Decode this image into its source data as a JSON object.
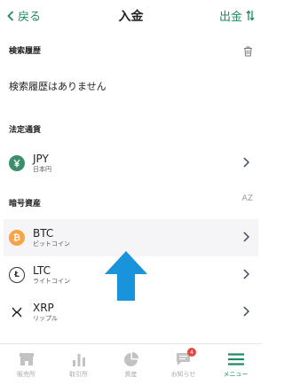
{
  "header": {
    "back_label": "戻る",
    "title": "入金",
    "withdraw_label": "出金"
  },
  "search_history": {
    "heading": "検索履歴",
    "empty_text": "検索履歴はありません"
  },
  "fiat": {
    "heading": "法定通貨",
    "items": [
      {
        "symbol": "JPY",
        "name": "日本円",
        "icon": "yen-icon",
        "color": "#3d8f6c"
      }
    ]
  },
  "crypto": {
    "heading": "暗号資産",
    "sort_label": "AZ",
    "items": [
      {
        "symbol": "BTC",
        "name": "ビットコイン",
        "icon": "bitcoin-icon",
        "color": "#f7a34a",
        "selected": true
      },
      {
        "symbol": "LTC",
        "name": "ライトコイン",
        "icon": "litecoin-icon",
        "color": "#ffffff"
      },
      {
        "symbol": "XRP",
        "name": "リップル",
        "icon": "ripple-icon",
        "color": "#ffffff"
      }
    ]
  },
  "tabbar": {
    "items": [
      {
        "label": "販売所",
        "icon": "shop-icon"
      },
      {
        "label": "取引所",
        "icon": "bar-chart-icon"
      },
      {
        "label": "資産",
        "icon": "pie-chart-icon"
      },
      {
        "label": "お知らせ",
        "icon": "message-icon",
        "badge": "4"
      },
      {
        "label": "メニュー",
        "icon": "menu-icon",
        "active": true
      }
    ]
  },
  "colors": {
    "accent": "#1f8a63",
    "pointer_arrow": "#1a93dd"
  }
}
